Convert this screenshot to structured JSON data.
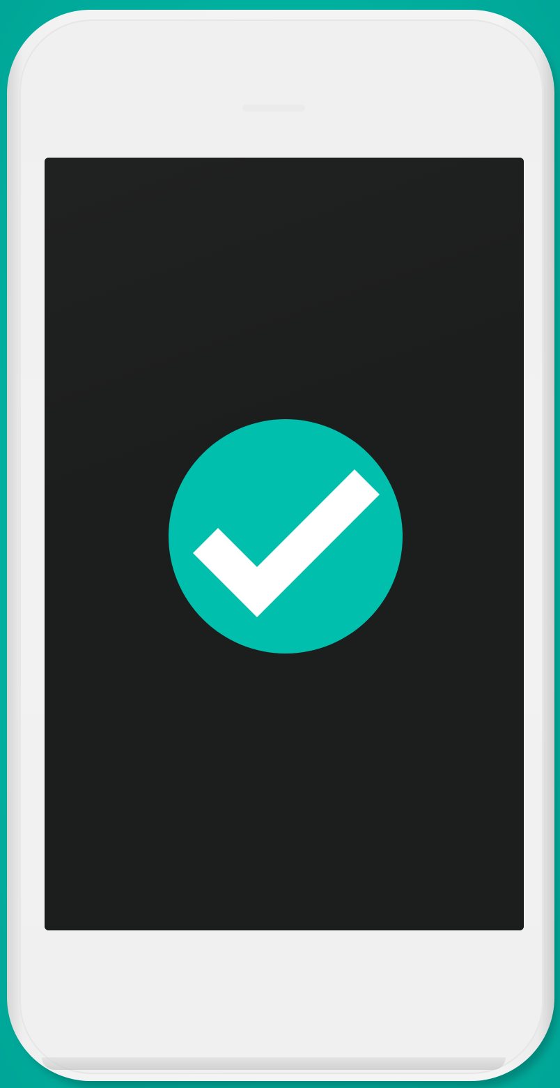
{
  "scene": {
    "background_color": "#00b3a4",
    "device": "white-smartphone",
    "device_color": "#f3f3f3",
    "screen_color": "#1c1d1d"
  },
  "badge": {
    "icon": "check-icon",
    "circle_color": "#00bfad",
    "check_color": "#ffffff"
  }
}
